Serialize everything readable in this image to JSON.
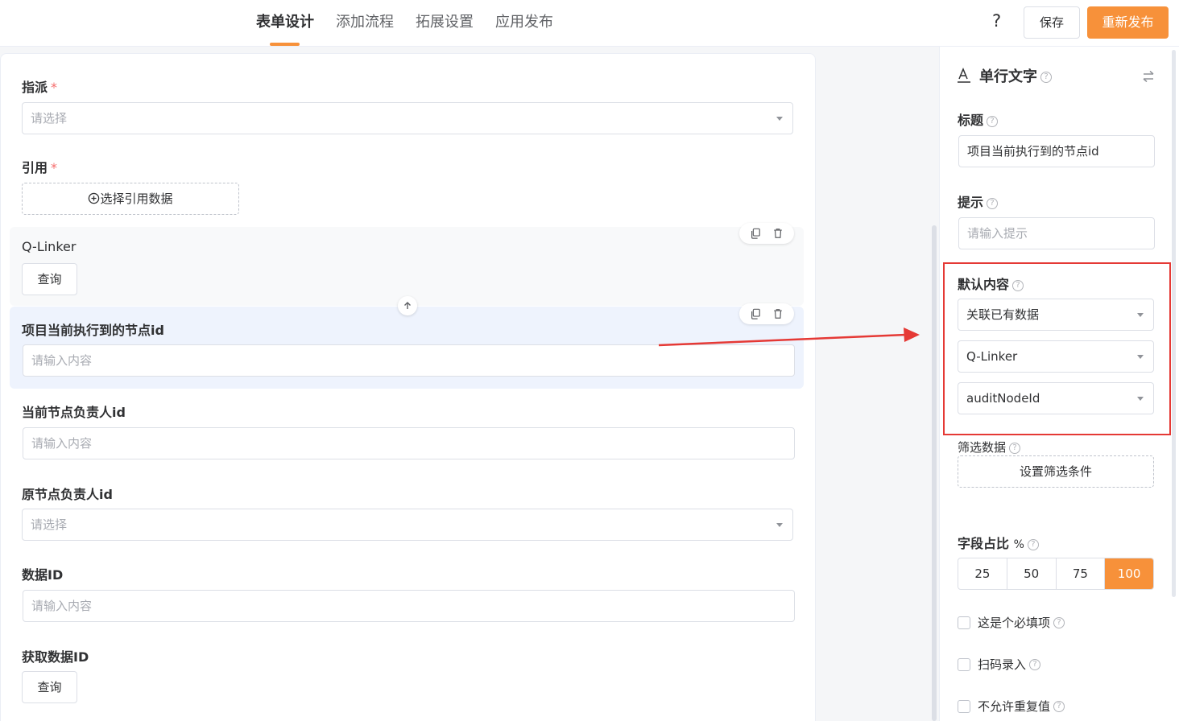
{
  "header": {
    "tabs": [
      "表单设计",
      "添加流程",
      "拓展设置",
      "应用发布"
    ],
    "help_label": "?",
    "save_label": "保存",
    "publish_label": "重新发布"
  },
  "form": {
    "assign": {
      "label": "指派",
      "required": "*",
      "placeholder": "请选择"
    },
    "reference": {
      "label": "引用",
      "required": "*",
      "button": "选择引用数据"
    },
    "qlinker": {
      "label": "Q-Linker",
      "button": "查询"
    },
    "node_id": {
      "label": "项目当前执行到的节点id",
      "placeholder": "请输入内容"
    },
    "owner_id": {
      "label": "当前节点负责人id",
      "placeholder": "请输入内容"
    },
    "orig_owner": {
      "label": "原节点负责人id",
      "placeholder": "请选择"
    },
    "data_id": {
      "label": "数据ID",
      "placeholder": "请输入内容"
    },
    "fetch_id": {
      "label": "获取数据ID",
      "button": "查询"
    }
  },
  "panel": {
    "title": "单行文字",
    "title_label": "标题",
    "title_value": "项目当前执行到的节点id",
    "hint_label": "提示",
    "hint_placeholder": "请输入提示",
    "default_label": "默认内容",
    "default_mode": "关联已有数据",
    "default_source": "Q-Linker",
    "default_field": "auditNodeId",
    "filter_label": "筛选数据",
    "filter_button": "设置筛选条件",
    "ratio_label": "字段占比",
    "ratio_unit": "%",
    "ratio_options": [
      "25",
      "50",
      "75",
      "100"
    ],
    "ratio_selected": "100",
    "checks": [
      "这是个必填项",
      "扫码录入",
      "不允许重复值"
    ]
  },
  "colors": {
    "accent": "#f7913a",
    "highlight": "#e53935"
  }
}
